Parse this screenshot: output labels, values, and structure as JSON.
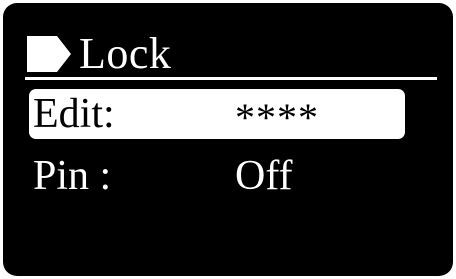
{
  "header": {
    "title": "Lock",
    "icon": "arrow-pointer-icon"
  },
  "menu": {
    "items": [
      {
        "label": "Edit:",
        "value": "****",
        "selected": true
      },
      {
        "label": "Pin :",
        "value": "Off",
        "selected": false
      }
    ]
  },
  "colors": {
    "background": "#000000",
    "foreground": "#ffffff",
    "highlight": "#ffffff",
    "highlight_text": "#000000"
  }
}
